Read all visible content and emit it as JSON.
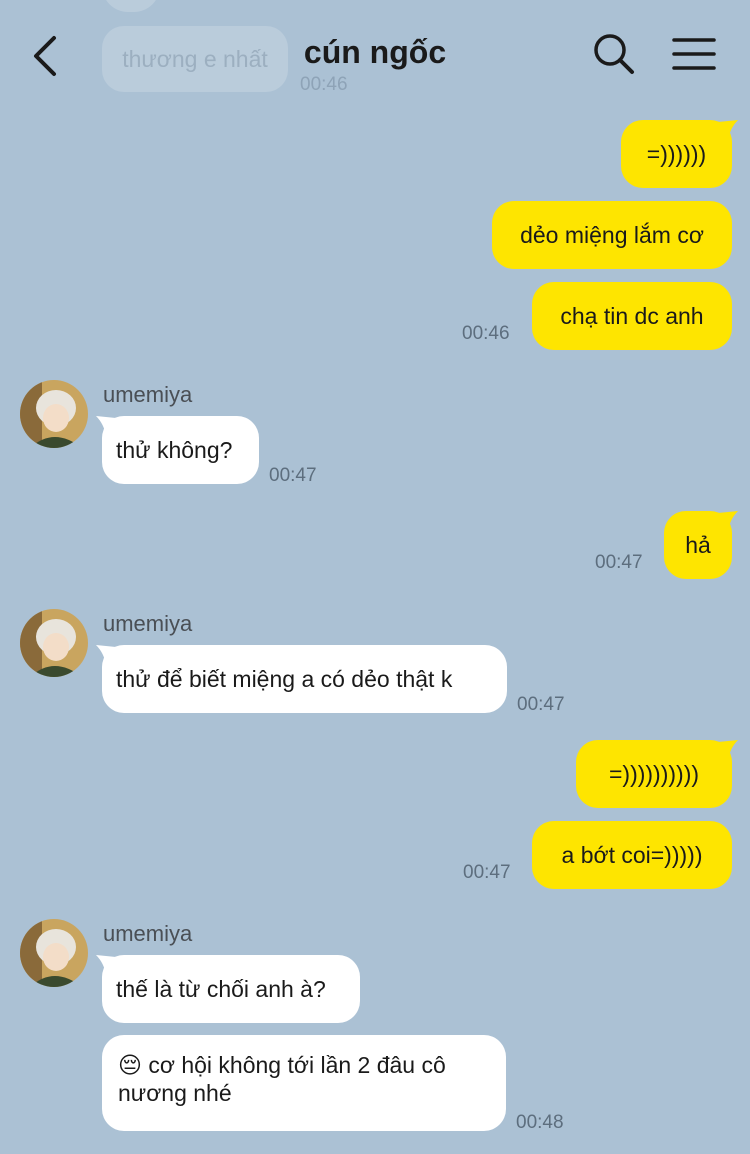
{
  "header": {
    "title": "cún ngốc"
  },
  "ghost": {
    "text": "thương e nhất",
    "time": "00:46"
  },
  "messages": {
    "m1": {
      "text": "=))))))"
    },
    "m2": {
      "text": "dẻo miệng lắm cơ"
    },
    "m3": {
      "text": "chạ tin dc anh",
      "time": "00:46"
    },
    "m4": {
      "sender": "umemiya",
      "text": "thử không?",
      "time": "00:47"
    },
    "m5": {
      "text": "hả",
      "time": "00:47"
    },
    "m6": {
      "sender": "umemiya",
      "text": "thử để biết miệng a có dẻo thật k",
      "time": "00:47"
    },
    "m7": {
      "text": "=))))))))))"
    },
    "m8": {
      "text": "a bớt coi=)))))",
      "time": "00:47"
    },
    "m9": {
      "sender": "umemiya",
      "text": "thế là từ chối anh à?"
    },
    "m10": {
      "emoji": "😔",
      "text": "cơ hội không tới lần 2 đâu cô nương nhé",
      "time": "00:48"
    }
  },
  "colors": {
    "background": "#abc1d4",
    "my_bubble": "#fee500",
    "their_bubble": "#ffffff"
  },
  "icons": {
    "back": "chevron-left-icon",
    "search": "search-icon",
    "menu": "hamburger-menu-icon"
  }
}
